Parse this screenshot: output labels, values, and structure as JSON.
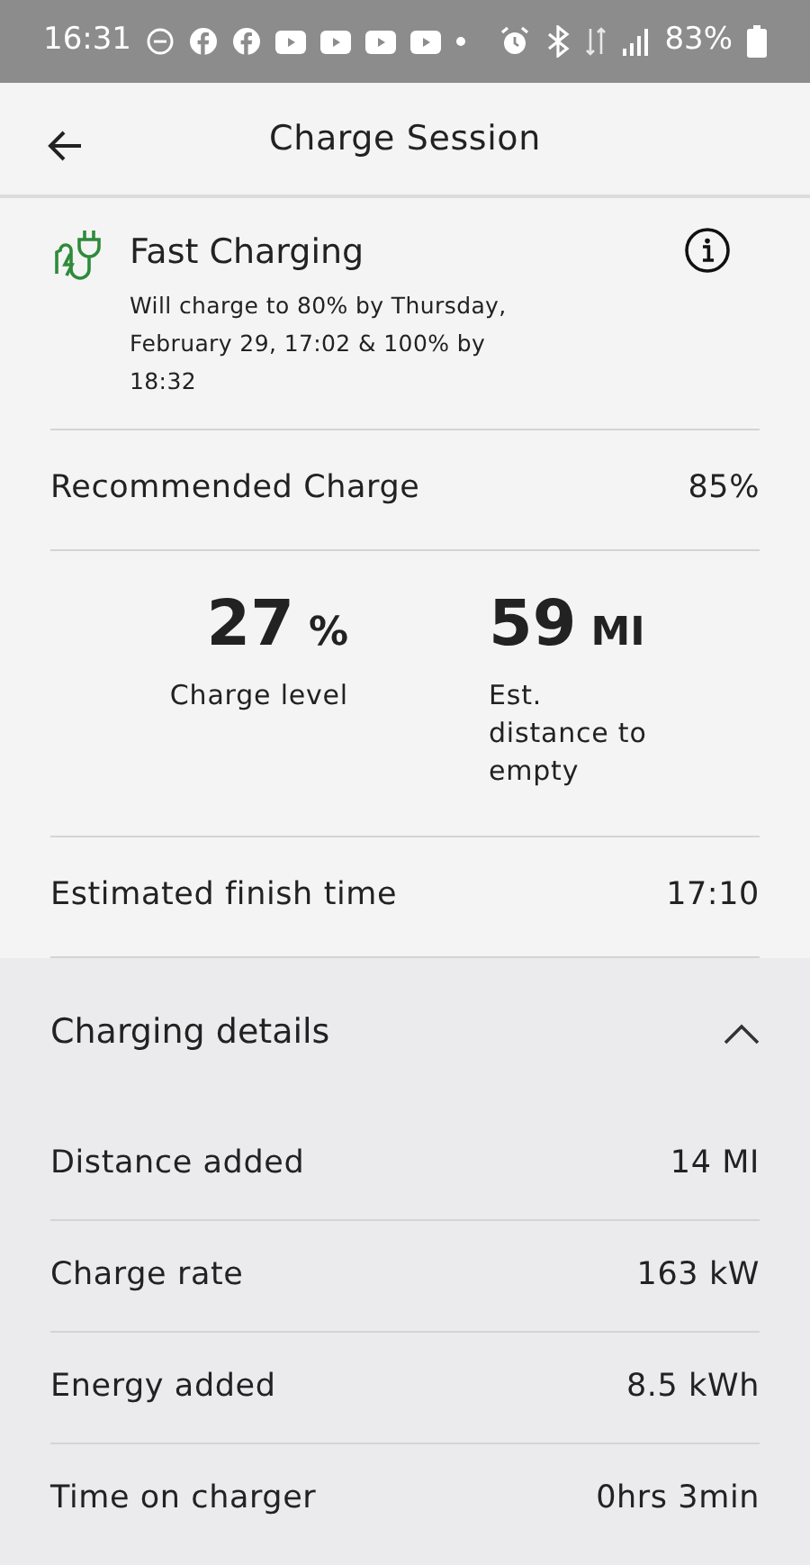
{
  "status_bar": {
    "time": "16:31",
    "battery": "83%"
  },
  "header": {
    "title": "Charge Session"
  },
  "charging_status": {
    "title": "Fast Charging",
    "description": "Will charge to 80% by Thursday, February 29, 17:02 & 100% by 18:32"
  },
  "recommended_charge": {
    "label": "Recommended Charge",
    "value": "85%"
  },
  "stats": [
    {
      "value": "27",
      "unit": "%",
      "label": "Charge level"
    },
    {
      "value": "59",
      "unit": "MI",
      "label": "Est. distance to empty"
    }
  ],
  "estimated_finish": {
    "label": "Estimated finish time",
    "value": "17:10"
  },
  "charging_details": {
    "title": "Charging details",
    "expanded": true,
    "rows": [
      {
        "label": "Distance added",
        "value": "14 MI"
      },
      {
        "label": "Charge rate",
        "value": "163 kW"
      },
      {
        "label": "Energy added",
        "value": "8.5 kWh"
      },
      {
        "label": "Time on charger",
        "value": "0hrs 3min"
      }
    ]
  }
}
